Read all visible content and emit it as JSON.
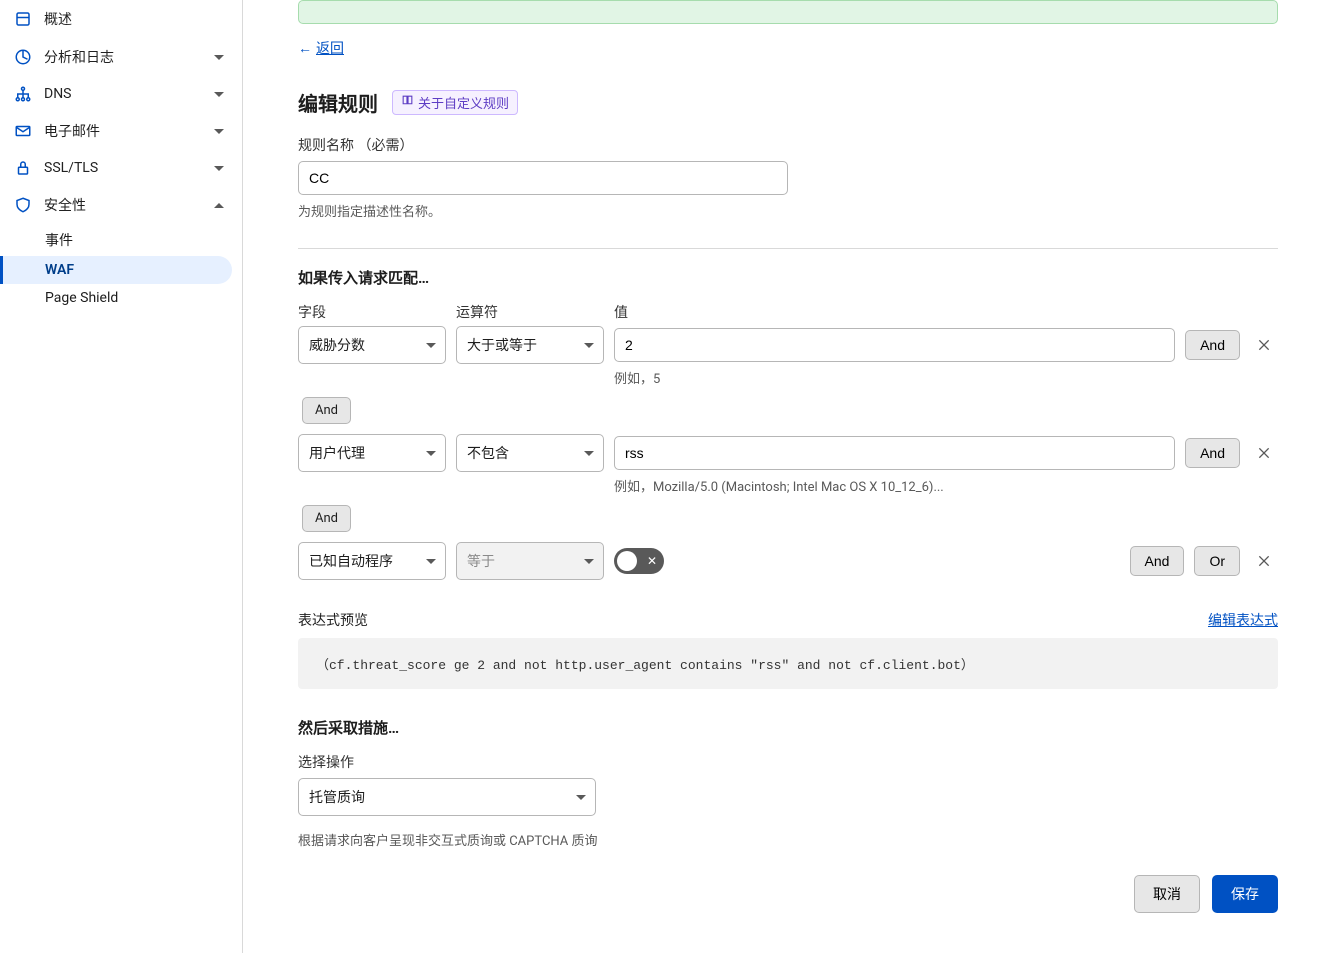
{
  "sidebar": {
    "items": [
      {
        "label": "概述",
        "icon": "overview"
      },
      {
        "label": "分析和日志",
        "icon": "analytics",
        "expandable": true
      },
      {
        "label": "DNS",
        "icon": "dns",
        "expandable": true
      },
      {
        "label": "电子邮件",
        "icon": "email",
        "expandable": true
      },
      {
        "label": "SSL/TLS",
        "icon": "lock",
        "expandable": true
      },
      {
        "label": "安全性",
        "icon": "shield",
        "expandable": true,
        "expanded": true,
        "children": [
          {
            "label": "事件"
          },
          {
            "label": "WAF",
            "active": true
          },
          {
            "label": "Page Shield"
          }
        ]
      }
    ]
  },
  "back_link": "返回",
  "page_title": "编辑规则",
  "about_badge": "关于自定义规则",
  "rule_name": {
    "label": "规则名称 （必需）",
    "value": "CC",
    "help": "为规则指定描述性名称。"
  },
  "match_section_title": "如果传入请求匹配…",
  "cond_headers": {
    "field": "字段",
    "operator": "运算符",
    "value": "值"
  },
  "conditions": [
    {
      "field": "威胁分数",
      "operator": "大于或等于",
      "value": "2",
      "example": "例如，5",
      "type": "text",
      "connectors": [
        "And"
      ]
    },
    {
      "field": "用户代理",
      "operator": "不包含",
      "value": "rss",
      "example": "例如，Mozilla/5.0 (Macintosh; Intel Mac OS X 10_12_6)...",
      "type": "text",
      "connectors": [
        "And"
      ]
    },
    {
      "field": "已知自动程序",
      "operator": "等于",
      "operator_disabled": true,
      "type": "toggle",
      "toggle_on": false,
      "connectors": [
        "And",
        "Or"
      ]
    }
  ],
  "between_connector": "And",
  "preview": {
    "label": "表达式预览",
    "edit_link": "编辑表达式",
    "expression": "（cf.threat_score ge 2 and not http.user_agent contains \"rss\" and not cf.client.bot）"
  },
  "action_section": {
    "title": "然后采取措施…",
    "select_label": "选择操作",
    "selected": "托管质询",
    "help": "根据请求向客户呈现非交互式质询或 CAPTCHA 质询"
  },
  "footer": {
    "cancel": "取消",
    "save": "保存"
  }
}
